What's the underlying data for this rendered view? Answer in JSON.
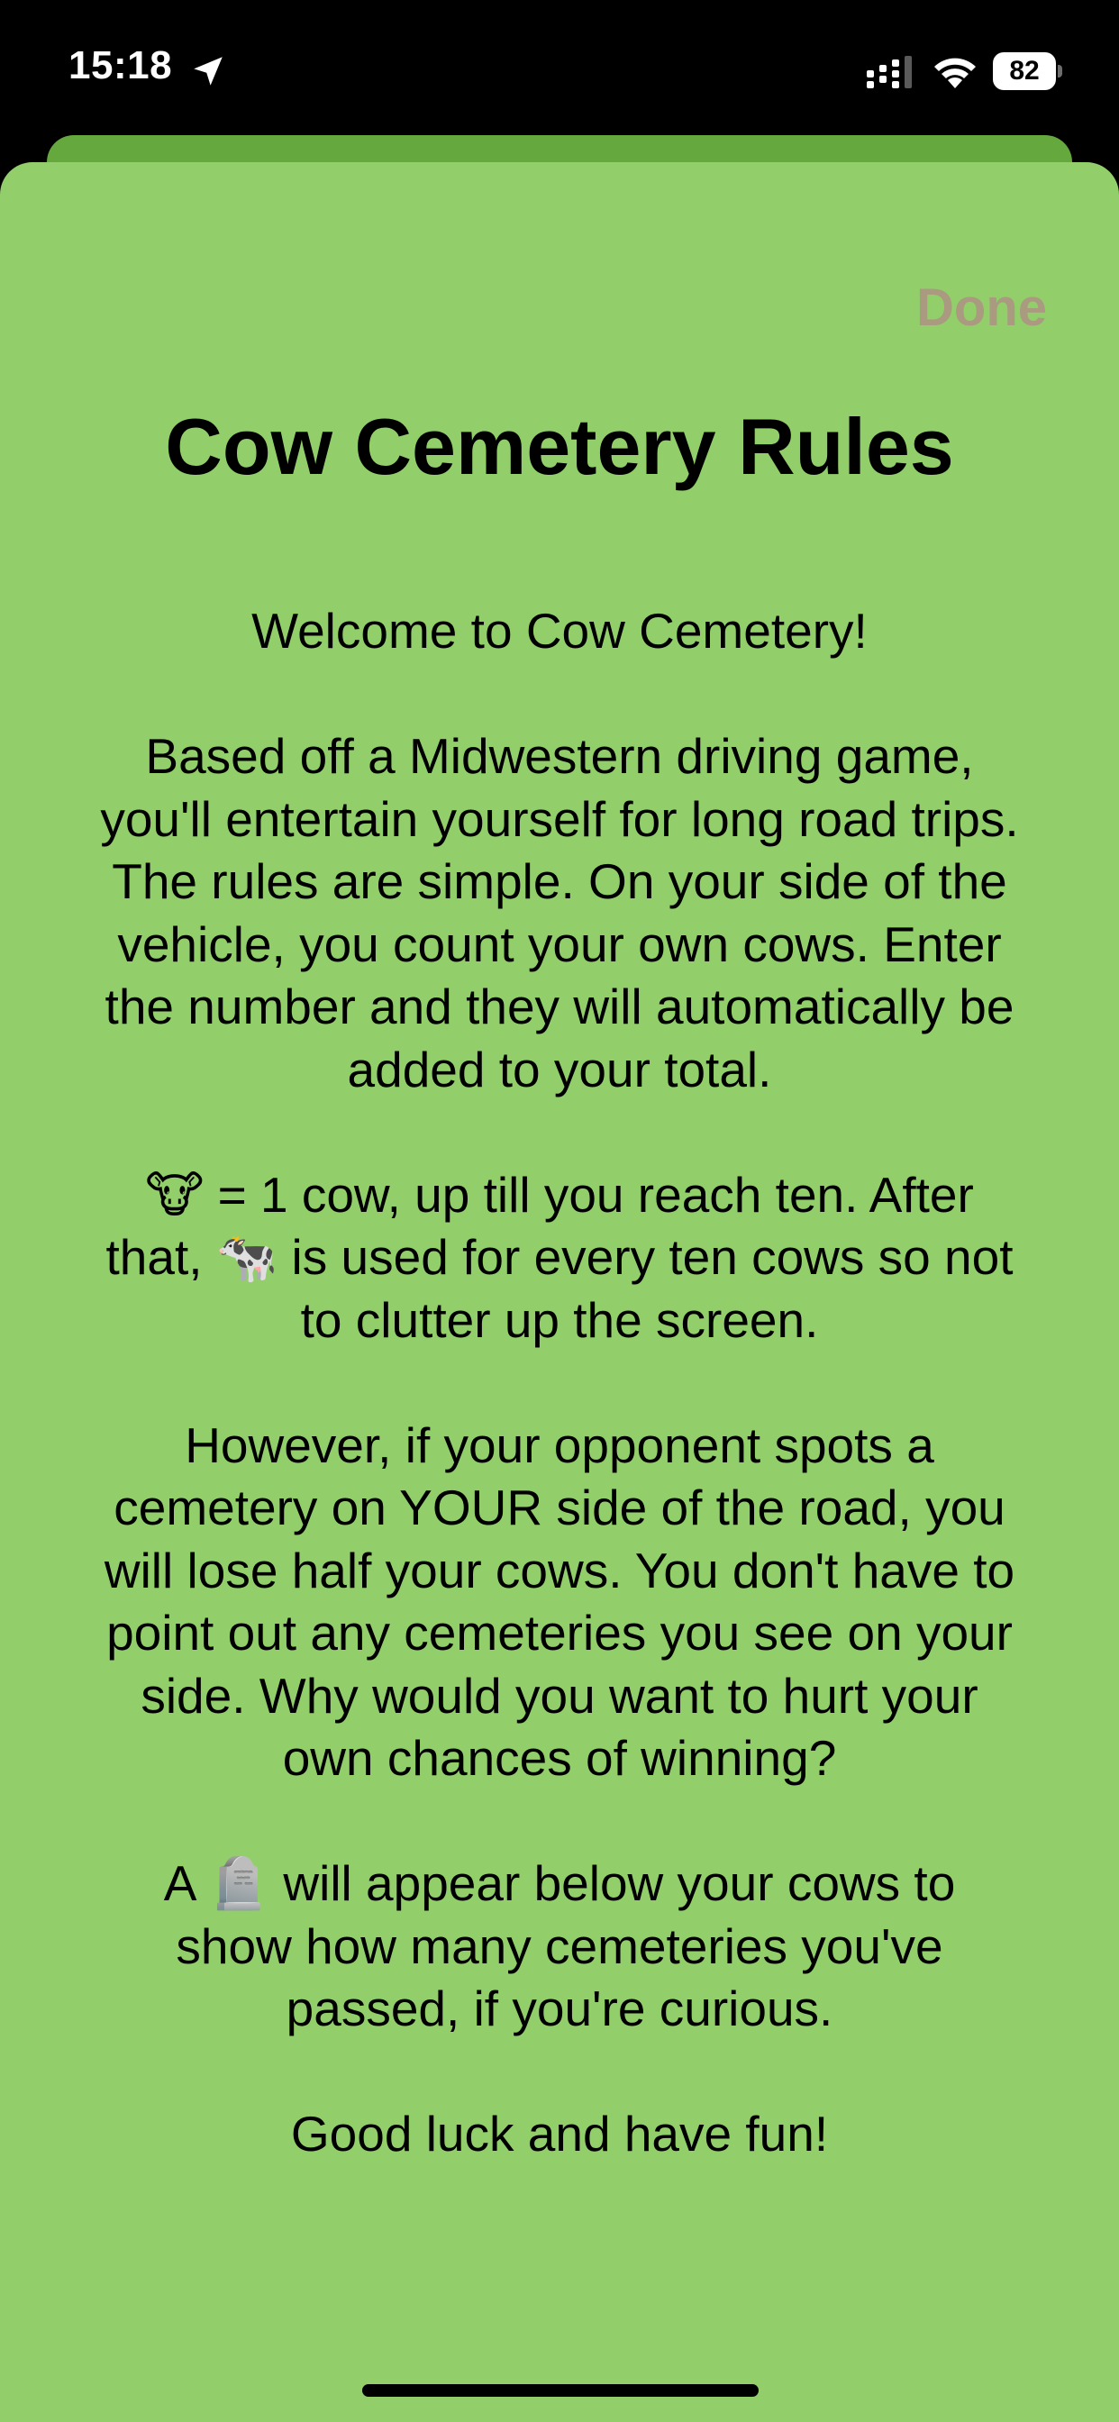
{
  "status_bar": {
    "time": "15:18",
    "battery_level": "82",
    "icons": [
      "location-arrow-icon",
      "signal-icon",
      "wifi-icon",
      "battery-icon"
    ]
  },
  "sheet": {
    "done_label": "Done",
    "title": "Cow Cemetery Rules",
    "paragraphs": [
      "Welcome to Cow Cemetery!",
      "Based off a Midwestern driving game, you'll entertain yourself for long road trips. The rules are simple. On your side of the vehicle, you count your own cows. Enter the number and they will automatically be added to your total.",
      "🐮 = 1 cow, up till you reach ten. After that, 🐄 is used for every ten cows so not to clutter up the screen.",
      " However, if your opponent spots a cemetery on YOUR side of the road, you will lose half your cows. You don't have to point out any cemeteries you see on your side. Why would you want to hurt your own chances of winning?",
      "A 🪦 will appear below your cows to show  how many cemeteries you've passed, if you're curious.",
      "Good luck and have fun!"
    ]
  },
  "colors": {
    "sheet_background": "#92cf6b",
    "back_card": "#64a83e",
    "done_text": "#a99a80",
    "status_bar_background": "#000000"
  }
}
